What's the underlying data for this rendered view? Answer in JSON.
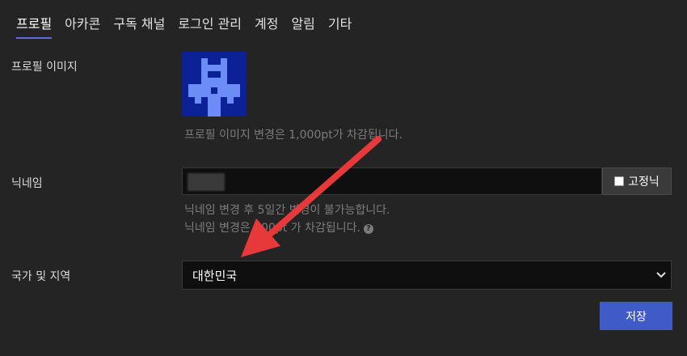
{
  "tabs": [
    {
      "label": "프로필",
      "active": true
    },
    {
      "label": "아카콘"
    },
    {
      "label": "구독 채널"
    },
    {
      "label": "로그인 관리"
    },
    {
      "label": "계정"
    },
    {
      "label": "알림"
    },
    {
      "label": "기타"
    }
  ],
  "profile_image": {
    "label": "프로필 이미지",
    "help": "프로필 이미지 변경은 1,000pt가 차감됩니다."
  },
  "nickname": {
    "label": "닉네임",
    "fixed_label": "고정닉",
    "help1": "닉네임 변경 후 5일간 변경이 불가능합니다.",
    "help2": "닉네임 변경은 500pt 가 차감됩니다."
  },
  "country": {
    "label": "국가 및 지역",
    "value": "대한민국"
  },
  "save_label": "저장",
  "colors": {
    "accent": "#3f5bc7",
    "annotation_arrow": "#e8393a"
  }
}
